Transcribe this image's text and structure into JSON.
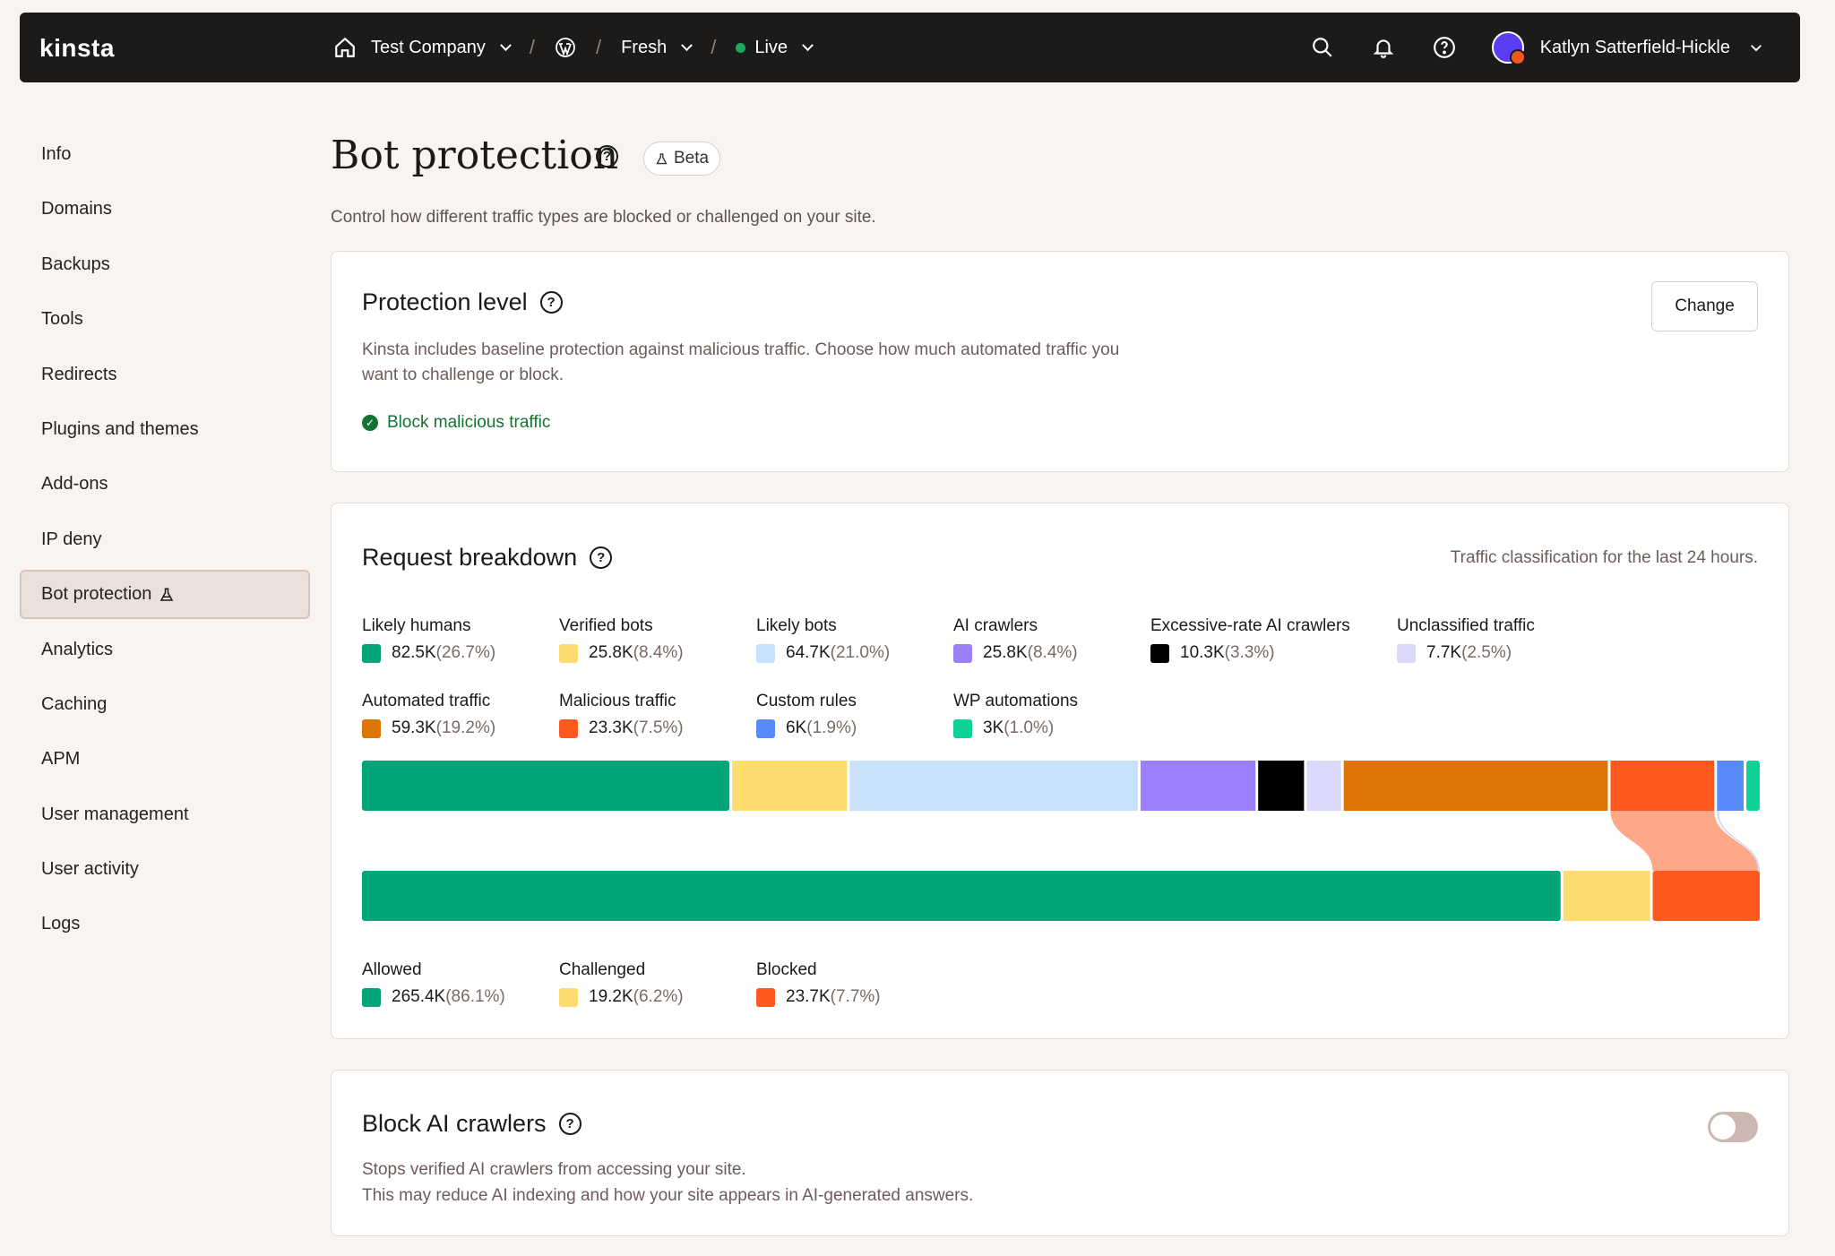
{
  "topbar": {
    "logo": "kinsta",
    "company": "Test Company",
    "site": "Fresh",
    "environment": "Live",
    "user_name": "Katlyn Satterfield-Hickle"
  },
  "sidebar": {
    "items": [
      {
        "label": "Info"
      },
      {
        "label": "Domains"
      },
      {
        "label": "Backups"
      },
      {
        "label": "Tools"
      },
      {
        "label": "Redirects"
      },
      {
        "label": "Plugins and themes"
      },
      {
        "label": "Add-ons"
      },
      {
        "label": "IP deny"
      },
      {
        "label": "Bot protection",
        "active": true
      },
      {
        "label": "Analytics"
      },
      {
        "label": "Caching"
      },
      {
        "label": "APM"
      },
      {
        "label": "User management"
      },
      {
        "label": "User activity"
      },
      {
        "label": "Logs"
      }
    ]
  },
  "page": {
    "title": "Bot protection",
    "beta_label": "Beta",
    "subtitle": "Control how different traffic types are blocked or challenged on your site."
  },
  "protection": {
    "title": "Protection level",
    "description": "Kinsta includes baseline protection against malicious traffic. Choose how much automated traffic you want to challenge or block.",
    "status": "Block malicious traffic",
    "change_label": "Change"
  },
  "breakdown": {
    "title": "Request breakdown",
    "note": "Traffic classification for the last 24 hours."
  },
  "ai_block": {
    "title": "Block AI crawlers",
    "line1": "Stops verified AI crawlers from accessing your site.",
    "line2": "This may reduce AI indexing and how your site appears in AI-generated answers.",
    "enabled": false
  },
  "chart_data": {
    "type": "sankey",
    "sources": [
      {
        "name": "Likely humans",
        "value_label": "82.5K",
        "pct_label": "(26.7%)",
        "value": 82.5,
        "color": "#02a47a"
      },
      {
        "name": "Verified bots",
        "value_label": "25.8K",
        "pct_label": "(8.4%)",
        "value": 25.8,
        "color": "#fedc70"
      },
      {
        "name": "Likely bots",
        "value_label": "64.7K",
        "pct_label": "(21.0%)",
        "value": 64.7,
        "color": "#c8e1fc"
      },
      {
        "name": "AI crawlers",
        "value_label": "25.8K",
        "pct_label": "(8.4%)",
        "value": 25.8,
        "color": "#9a7efa"
      },
      {
        "name": "Excessive-rate AI crawlers",
        "value_label": "10.3K",
        "pct_label": "(3.3%)",
        "value": 10.3,
        "color": "#000000"
      },
      {
        "name": "Unclassified traffic",
        "value_label": "7.7K",
        "pct_label": "(2.5%)",
        "value": 7.7,
        "color": "#dcdafc"
      },
      {
        "name": "Automated traffic",
        "value_label": "59.3K",
        "pct_label": "(19.2%)",
        "value": 59.3,
        "color": "#dc7504"
      },
      {
        "name": "Malicious traffic",
        "value_label": "23.3K",
        "pct_label": "(7.5%)",
        "value": 23.3,
        "color": "#fd591e"
      },
      {
        "name": "Custom rules",
        "value_label": "6K",
        "pct_label": "(1.9%)",
        "value": 6.0,
        "color": "#568bf9"
      },
      {
        "name": "WP automations",
        "value_label": "3K",
        "pct_label": "(1.0%)",
        "value": 3.0,
        "color": "#0dd295"
      }
    ],
    "targets": [
      {
        "name": "Allowed",
        "value_label": "265.4K",
        "pct_label": "(86.1%)",
        "value": 265.4,
        "color": "#02a47a"
      },
      {
        "name": "Challenged",
        "value_label": "19.2K",
        "pct_label": "(6.2%)",
        "value": 19.2,
        "color": "#fedc70"
      },
      {
        "name": "Blocked",
        "value_label": "23.7K",
        "pct_label": "(7.7%)",
        "value": 23.7,
        "color": "#fd591e"
      }
    ],
    "flows": [
      {
        "from": "Malicious traffic",
        "to": "Blocked",
        "value": 23.3,
        "color": "#fea88a"
      },
      {
        "from": "Custom rules",
        "to": "Blocked",
        "value": 0.4,
        "color": "#c9d9fb"
      }
    ]
  }
}
